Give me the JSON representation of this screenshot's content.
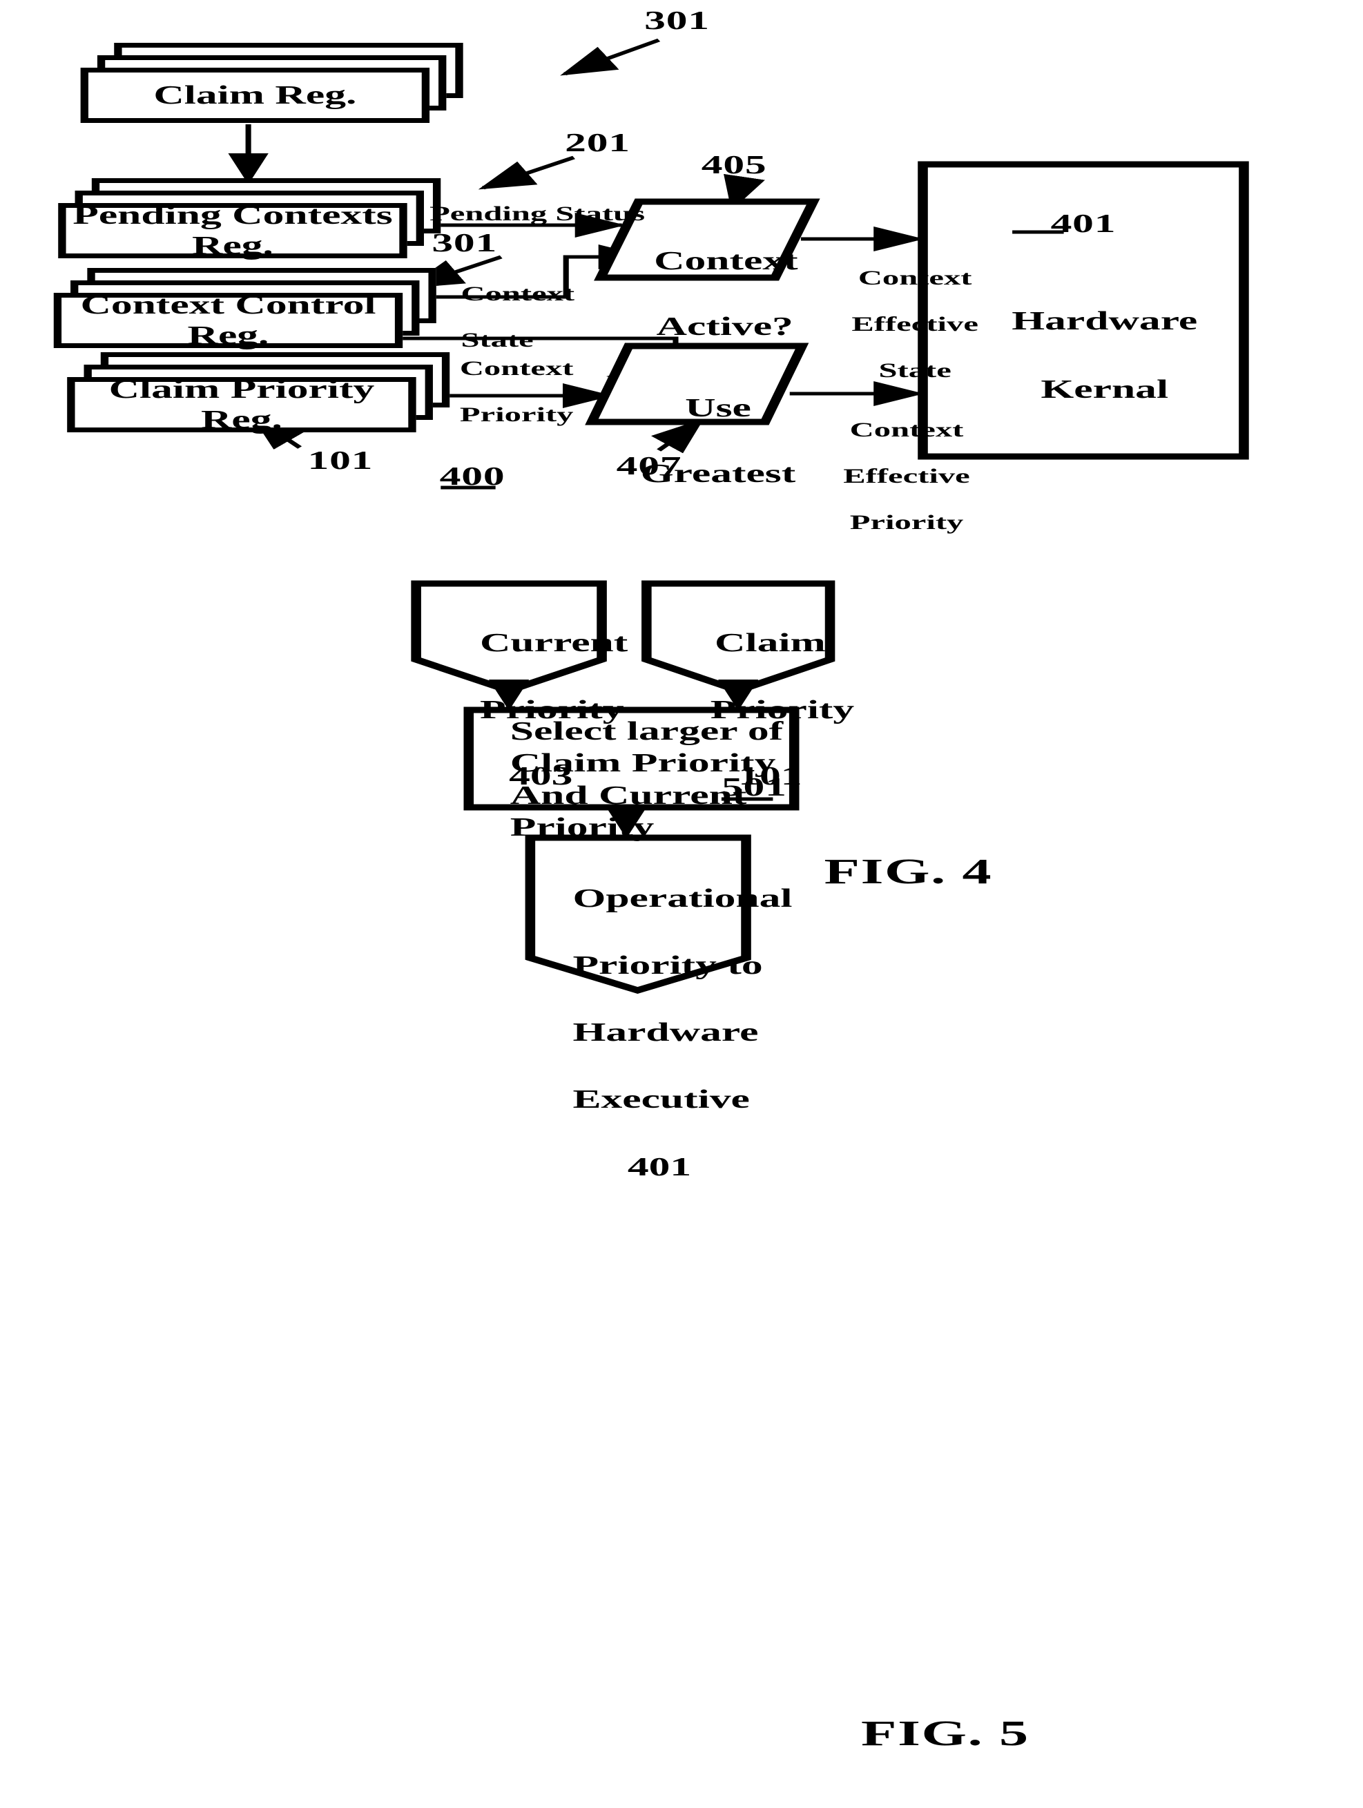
{
  "figures": [
    {
      "caption": "FIG. 4",
      "figure_ref": "400"
    },
    {
      "caption": "FIG. 5"
    }
  ],
  "fig4": {
    "caption": "FIG. 4",
    "figure_ref": "400",
    "blocks": {
      "claim_reg": {
        "label": "Claim  Reg.",
        "ref": "301"
      },
      "pending_contexts_reg": {
        "label": "Pending Contexts Reg.",
        "ref": "201"
      },
      "context_control_reg": {
        "label": "Context Control Reg.",
        "ref": "301"
      },
      "claim_priority_reg": {
        "label": "Claim Priority Reg.",
        "ref": "101"
      },
      "context_active": {
        "label_line1": "Context",
        "label_line2": "Active?",
        "ref": "405"
      },
      "use_greatest": {
        "label_line1": "Use",
        "label_line2": "Greatest",
        "ref": "407"
      },
      "hardware_kernal": {
        "ref": "401",
        "label_line1": "Hardware",
        "label_line2": "Kernal"
      }
    },
    "edges": {
      "pending_status": "Pending Status",
      "context_state_l1": "Context",
      "context_state_l2": "State",
      "context_priority_l1": "Context",
      "context_priority_l2": "Priority",
      "context_effective_state_l1": "Context",
      "context_effective_state_l2": "Effective",
      "context_effective_state_l3": "State",
      "context_effective_priority_l1": "Context",
      "context_effective_priority_l2": "Effective",
      "context_effective_priority_l3": "Priority"
    }
  },
  "fig5": {
    "caption": "FIG. 5",
    "blocks": {
      "current_priority": {
        "line1": "Current",
        "line2": "Priority",
        "ref": "403"
      },
      "claim_priority": {
        "line1": "Claim",
        "line2": "Priority",
        "ref": "101"
      },
      "select_larger": {
        "line1": "Select larger of",
        "line2": "Claim Priority",
        "line3": "And Current",
        "line4": "Priority",
        "ref": "501"
      },
      "operational_priority": {
        "line1": "Operational",
        "line2": "Priority to",
        "line3": "Hardware",
        "line4": "Executive",
        "ref": "401"
      }
    }
  },
  "colors": {
    "ink": "#000000",
    "paper": "#ffffff"
  }
}
